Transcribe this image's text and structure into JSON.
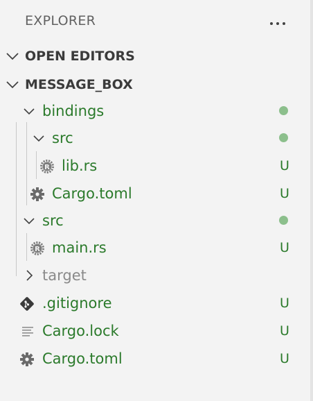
{
  "header": {
    "title": "EXPLORER",
    "more_icon": "ellipsis-icon"
  },
  "sections": {
    "open_editors": {
      "label": "OPEN EDITORS",
      "expanded": false
    },
    "project": {
      "label": "MESSAGE_BOX",
      "expanded": true
    }
  },
  "tree": [
    {
      "name": "bindings",
      "kind": "folder",
      "expanded": true,
      "status": "dot",
      "color": "green"
    },
    {
      "name": "src",
      "kind": "folder",
      "expanded": true,
      "status": "dot",
      "color": "green"
    },
    {
      "name": "lib.rs",
      "kind": "rust-file",
      "status": "U",
      "color": "green"
    },
    {
      "name": "Cargo.toml",
      "kind": "toml-file",
      "status": "U",
      "color": "green"
    },
    {
      "name": "src",
      "kind": "folder",
      "expanded": true,
      "status": "dot",
      "color": "green"
    },
    {
      "name": "main.rs",
      "kind": "rust-file",
      "status": "U",
      "color": "green"
    },
    {
      "name": "target",
      "kind": "folder",
      "expanded": false,
      "status": "",
      "color": "grey"
    },
    {
      "name": ".gitignore",
      "kind": "git-file",
      "status": "U",
      "color": "green"
    },
    {
      "name": "Cargo.lock",
      "kind": "lock-file",
      "status": "U",
      "color": "green"
    },
    {
      "name": "Cargo.toml",
      "kind": "toml-file",
      "status": "U",
      "color": "green"
    }
  ],
  "colors": {
    "untracked_text": "#2b7a2b",
    "ignored_text": "#8a8a8a",
    "modified_dot": "#8cbf8c"
  }
}
